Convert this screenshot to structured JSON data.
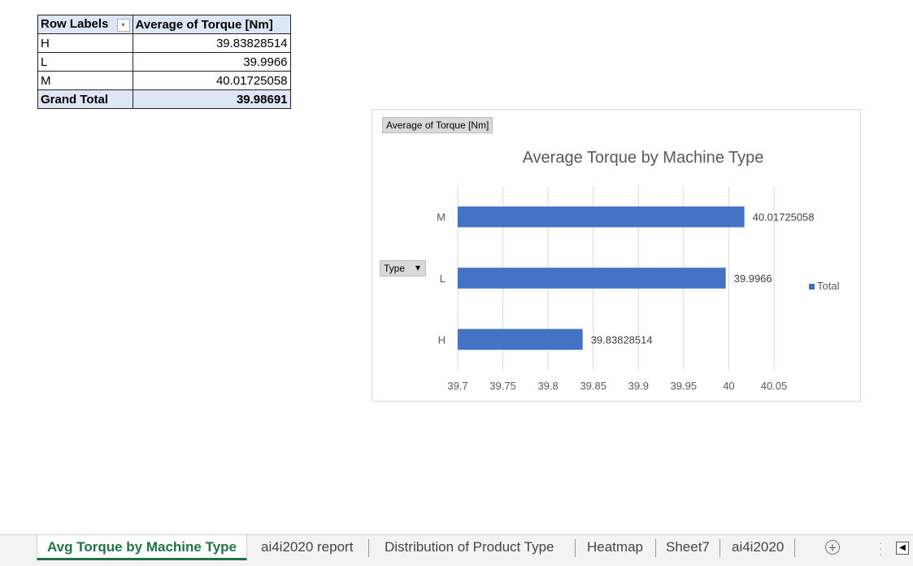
{
  "pivot": {
    "headers": [
      "Row Labels",
      "Average of Torque [Nm]"
    ],
    "rows": [
      {
        "label": "H",
        "value": "39.83828514"
      },
      {
        "label": "L",
        "value": "39.9966"
      },
      {
        "label": "M",
        "value": "40.01725058"
      }
    ],
    "total": {
      "label": "Grand Total",
      "value": "39.98691"
    }
  },
  "chart": {
    "value_field_button": "Average of Torque [Nm]",
    "axis_field_button": "Type",
    "legend_label": "Total"
  },
  "chart_data": {
    "type": "bar",
    "orientation": "horizontal",
    "title": "Average Torque by Machine Type",
    "categories": [
      "M",
      "L",
      "H"
    ],
    "values": [
      40.01725058,
      39.9966,
      39.83828514
    ],
    "data_labels": [
      "40.01725058",
      "39.9966",
      "39.83828514"
    ],
    "xlim": [
      39.7,
      40.05
    ],
    "x_ticks": [
      "39.7",
      "39.75",
      "39.8",
      "39.85",
      "39.9",
      "39.95",
      "40",
      "40.05"
    ],
    "series": [
      {
        "name": "Total",
        "values": [
          40.01725058,
          39.9966,
          39.83828514
        ]
      }
    ],
    "grid": true,
    "legend_position": "right",
    "bar_color": "#4472c4"
  },
  "tabs": [
    {
      "label": "Avg Torque by Machine Type",
      "active": true
    },
    {
      "label": "ai4i2020 report",
      "active": false
    },
    {
      "label": "Distribution of Product Type",
      "active": false
    },
    {
      "label": "Heatmap",
      "active": false
    },
    {
      "label": "Sheet7",
      "active": false
    },
    {
      "label": "ai4i2020",
      "active": false
    }
  ],
  "icons": {
    "add_sheet": "plus-circle-icon",
    "scroll_left": "triangle-left-icon",
    "filter": "dropdown-arrow-icon"
  }
}
